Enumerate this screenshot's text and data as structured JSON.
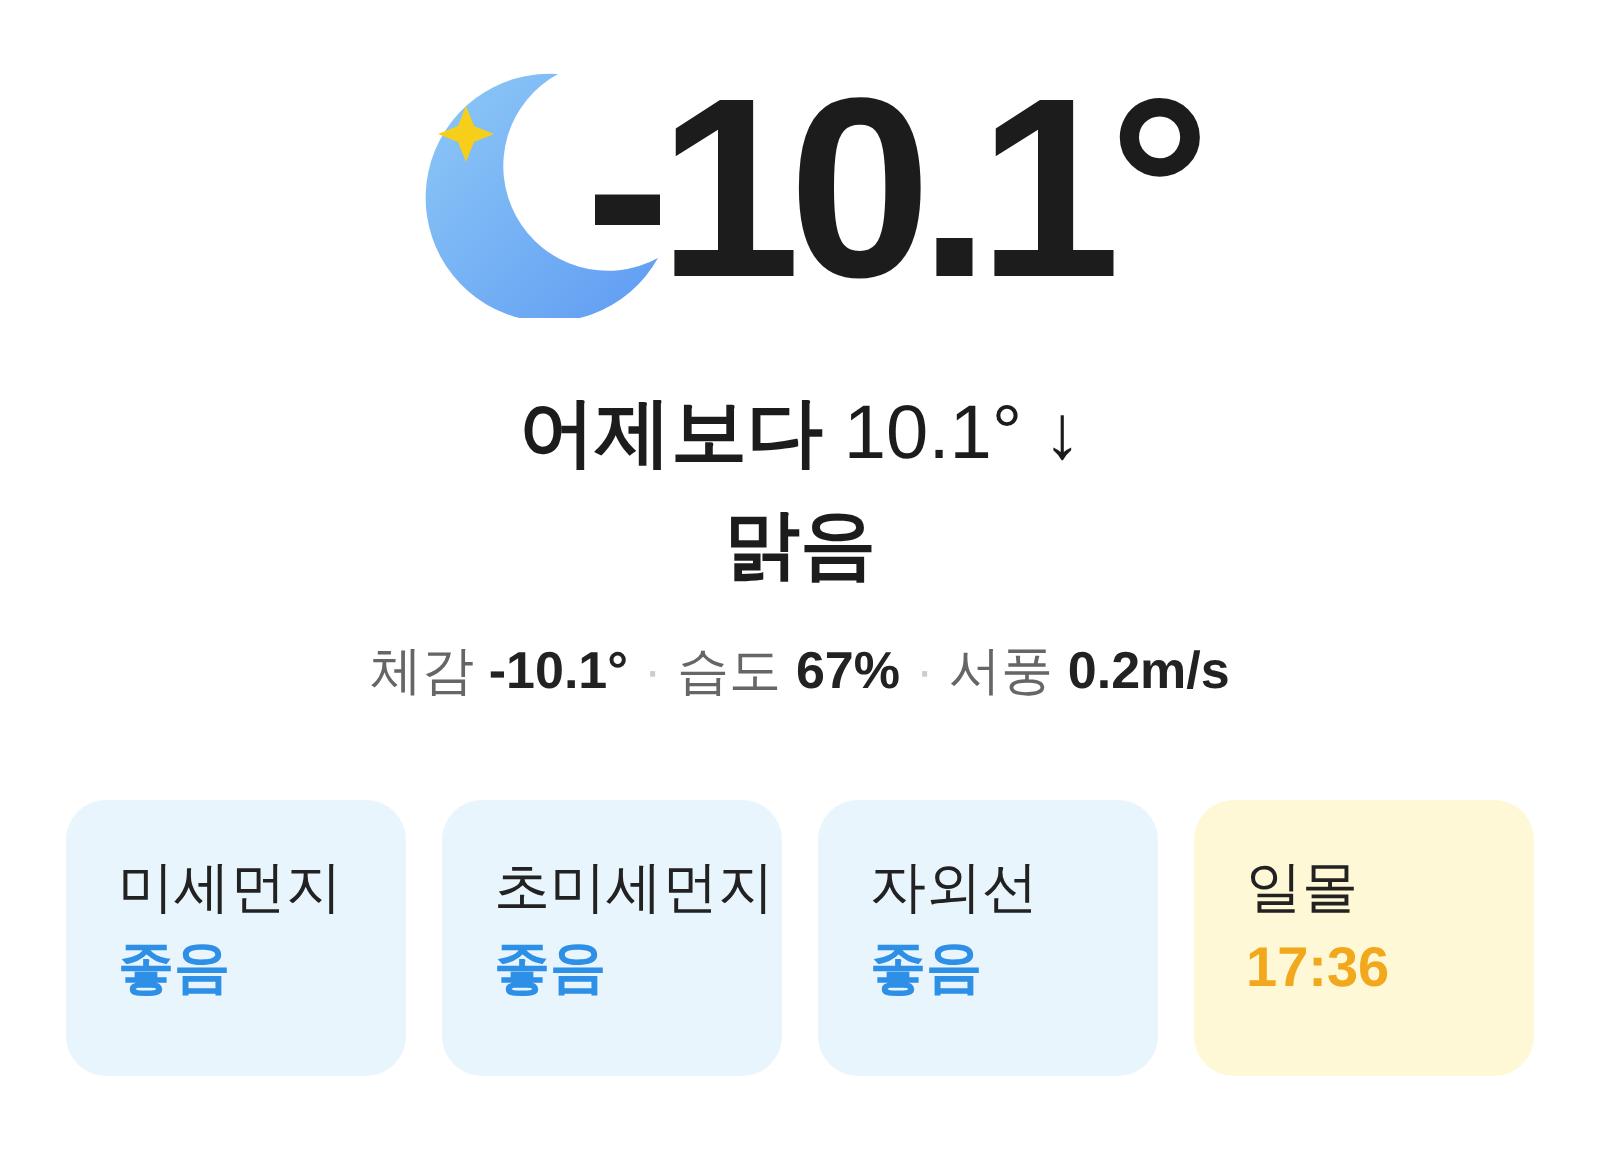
{
  "current": {
    "temperature": "-10.1°"
  },
  "compare": {
    "label": "어제보다",
    "value": "10.1°",
    "arrow": "↓"
  },
  "condition": "맑음",
  "details": [
    {
      "label": "체감",
      "value": "-10.1°"
    },
    {
      "label": "습도",
      "value": "67%"
    },
    {
      "label": "서풍",
      "value": "0.2m/s"
    }
  ],
  "separator": "·",
  "cards": [
    {
      "kind": "air",
      "title": "미세먼지",
      "value": "좋음"
    },
    {
      "kind": "air",
      "title": "초미세먼지",
      "value": "좋음"
    },
    {
      "kind": "air",
      "title": "자외선",
      "value": "좋음"
    },
    {
      "kind": "sun",
      "title": "일몰",
      "value": "17:36"
    }
  ]
}
